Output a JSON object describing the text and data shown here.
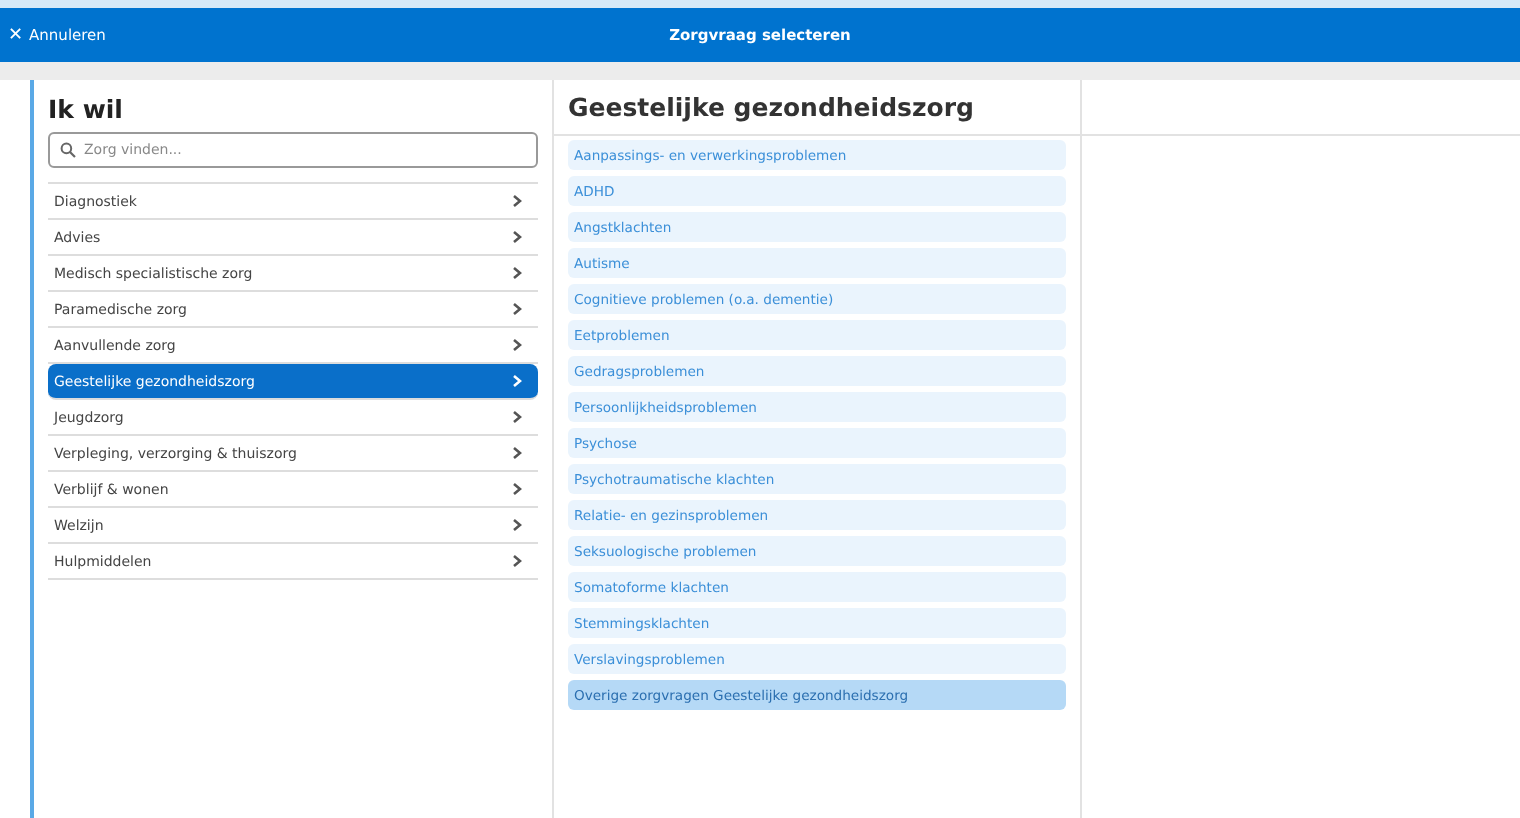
{
  "header": {
    "cancel": "Annuleren",
    "cancel_icon": "✕",
    "title": "Zorgvraag selecteren"
  },
  "categories": {
    "title": "Ik wil",
    "search": {
      "placeholder": "Zorg vinden..."
    },
    "items": [
      {
        "label": "Diagnostiek",
        "selected": false
      },
      {
        "label": "Advies",
        "selected": false
      },
      {
        "label": "Medisch specialistische zorg",
        "selected": false
      },
      {
        "label": "Paramedische zorg",
        "selected": false
      },
      {
        "label": "Aanvullende zorg",
        "selected": false
      },
      {
        "label": "Geestelijke gezondheidszorg",
        "selected": true
      },
      {
        "label": "Jeugdzorg",
        "selected": false
      },
      {
        "label": "Verpleging, verzorging & thuiszorg",
        "selected": false
      },
      {
        "label": "Verblijf & wonen",
        "selected": false
      },
      {
        "label": "Welzijn",
        "selected": false
      },
      {
        "label": "Hulpmiddelen",
        "selected": false
      }
    ]
  },
  "care_questions": {
    "title": "Geestelijke gezondheidszorg",
    "items": [
      {
        "label": "Aanpassings- en verwerkingsproblemen",
        "selected": false
      },
      {
        "label": "ADHD",
        "selected": false
      },
      {
        "label": "Angstklachten",
        "selected": false
      },
      {
        "label": "Autisme",
        "selected": false
      },
      {
        "label": "Cognitieve problemen (o.a. dementie)",
        "selected": false
      },
      {
        "label": "Eetproblemen",
        "selected": false
      },
      {
        "label": "Gedragsproblemen",
        "selected": false
      },
      {
        "label": "Persoonlijkheidsproblemen",
        "selected": false
      },
      {
        "label": "Psychose",
        "selected": false
      },
      {
        "label": "Psychotraumatische klachten",
        "selected": false
      },
      {
        "label": "Relatie- en gezinsproblemen",
        "selected": false
      },
      {
        "label": "Seksuologische problemen",
        "selected": false
      },
      {
        "label": "Somatoforme klachten",
        "selected": false
      },
      {
        "label": "Stemmingsklachten",
        "selected": false
      },
      {
        "label": "Verslavingsproblemen",
        "selected": false
      },
      {
        "label": "Overige zorgvragen Geestelijke gezondheidszorg",
        "selected": true
      }
    ]
  }
}
